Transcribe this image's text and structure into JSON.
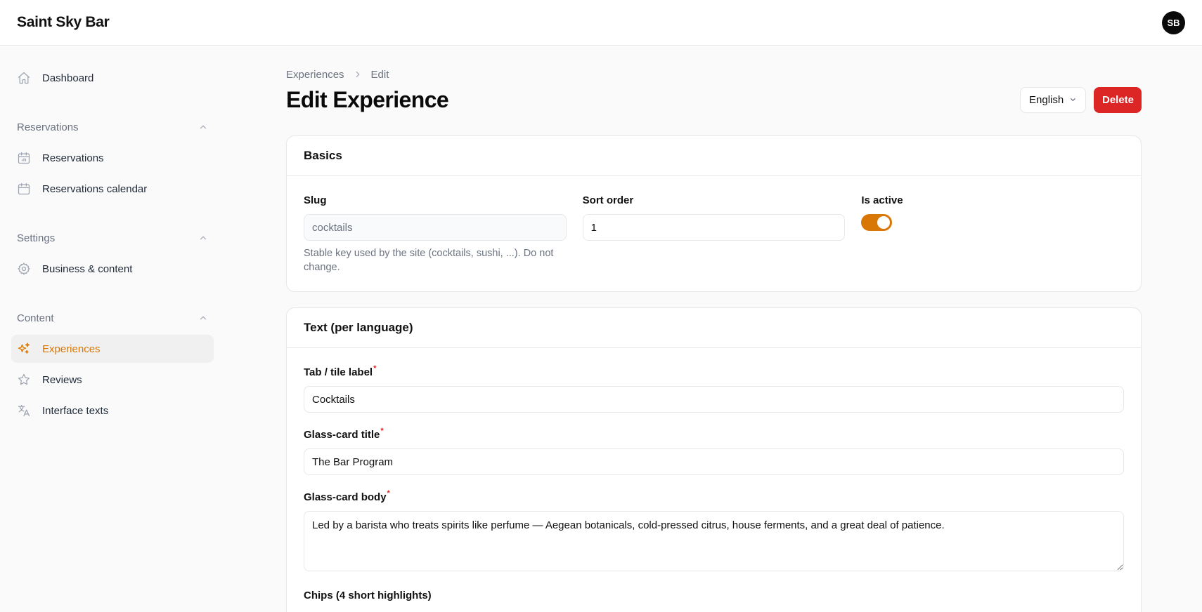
{
  "app": {
    "title": "Saint Sky Bar",
    "user_initials": "SB"
  },
  "sidebar": {
    "dashboard": "Dashboard",
    "groups": {
      "reservations": {
        "label": "Reservations",
        "items": [
          "Reservations",
          "Reservations calendar"
        ]
      },
      "settings": {
        "label": "Settings",
        "items": [
          "Business & content"
        ]
      },
      "content": {
        "label": "Content",
        "items": [
          "Experiences",
          "Reviews",
          "Interface texts"
        ]
      }
    },
    "active_item": "Experiences"
  },
  "breadcrumb": [
    "Experiences",
    "Edit"
  ],
  "page": {
    "title": "Edit Experience",
    "language": "English",
    "delete_label": "Delete"
  },
  "basics": {
    "title": "Basics",
    "slug_label": "Slug",
    "slug_value": "cocktails",
    "slug_hint": "Stable key used by the site (cocktails, sushi, ...). Do not change.",
    "sort_label": "Sort order",
    "sort_value": "1",
    "active_label": "Is active",
    "active": true
  },
  "text_section": {
    "title": "Text (per language)",
    "tab_label": "Tab / tile label",
    "tab_value": "Cocktails",
    "card_title_label": "Glass-card title",
    "card_title_value": "The Bar Program",
    "card_body_label": "Glass-card body",
    "card_body_value": "Led by a barista who treats spirits like perfume — Aegean botanicals, cold-pressed citrus, house ferments, and a great deal of patience.",
    "chips_label": "Chips (4 short highlights)",
    "required_mark": "*"
  },
  "colors": {
    "accent": "#d97706",
    "danger": "#dc2626"
  }
}
